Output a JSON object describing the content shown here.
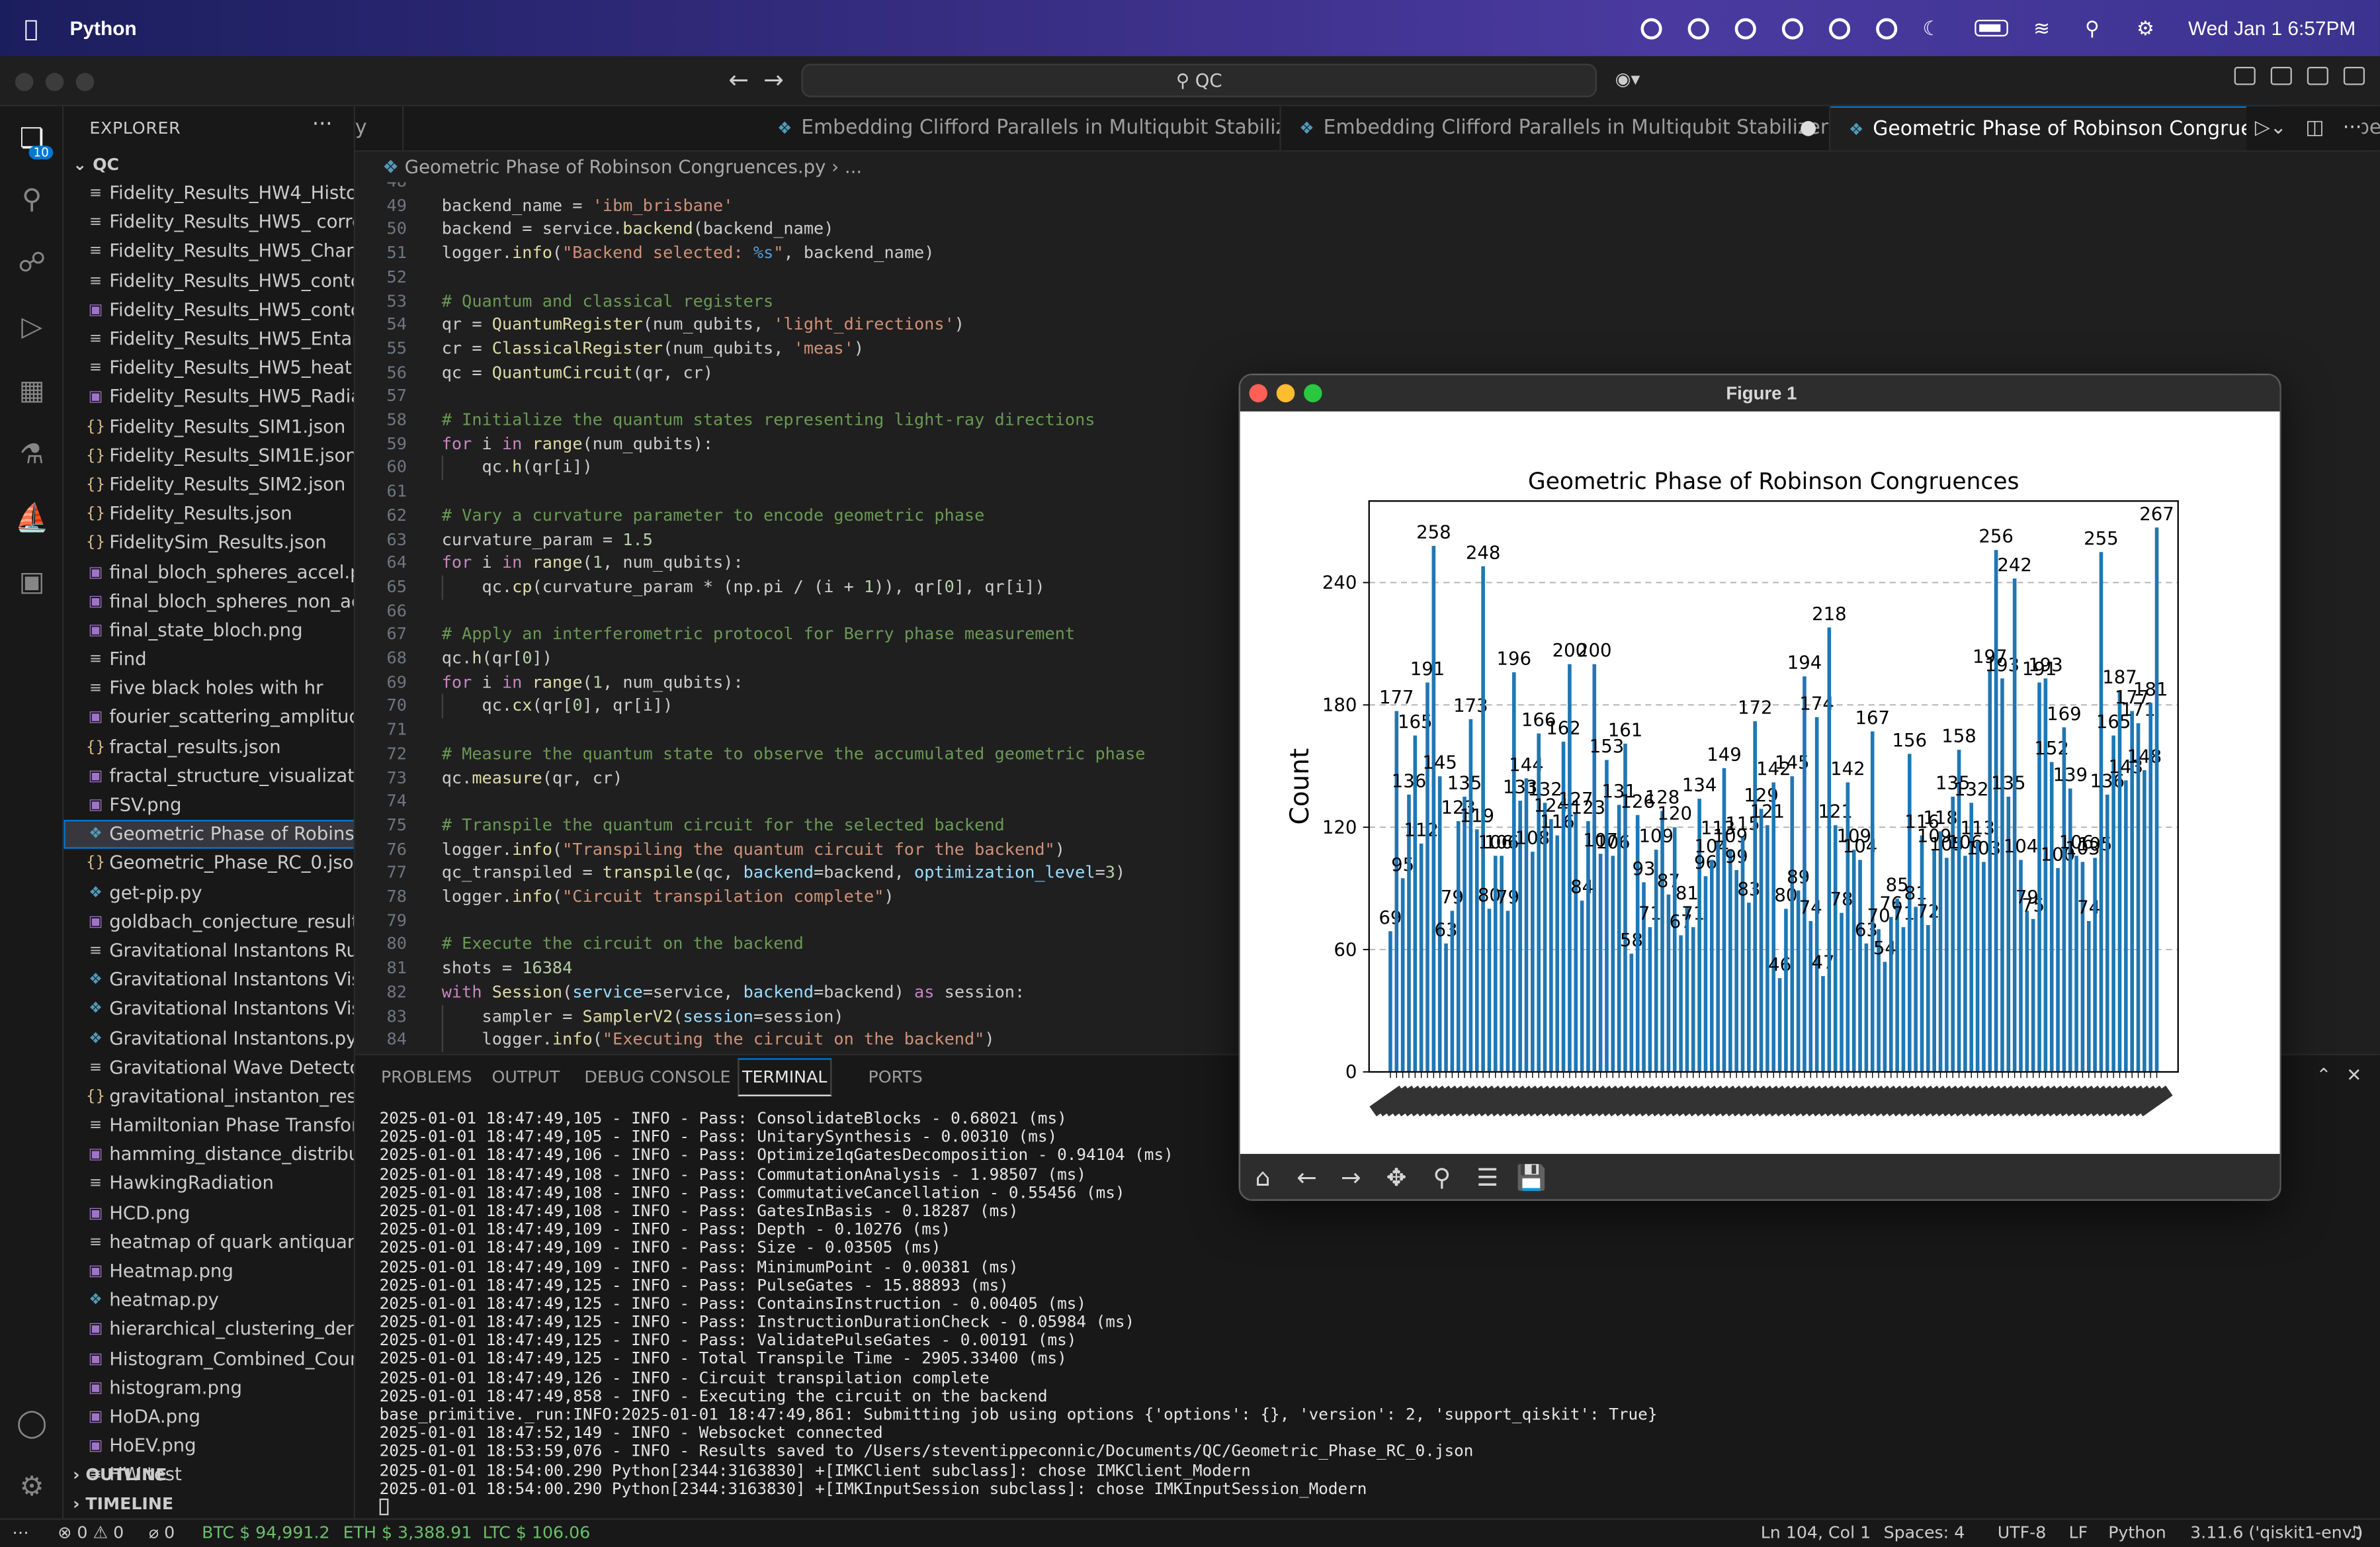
{
  "menubar": {
    "app": "Python",
    "datetime": "Wed Jan 1  6:57PM"
  },
  "titlebar": {
    "search": "QC"
  },
  "activity": {
    "badge": "10"
  },
  "explorer": {
    "title": "EXPLORER",
    "root": "QC",
    "files": [
      {
        "name": "Fidelity_Results_HW4_Histo...",
        "kind": "txt"
      },
      {
        "name": "Fidelity_Results_HW5_ corre...",
        "kind": "txt"
      },
      {
        "name": "Fidelity_Results_HW5_Chart1",
        "kind": "txt"
      },
      {
        "name": "Fidelity_Results_HW5_conto...",
        "kind": "txt"
      },
      {
        "name": "Fidelity_Results_HW5_conto...",
        "kind": "png"
      },
      {
        "name": "Fidelity_Results_HW5_Entan...",
        "kind": "txt"
      },
      {
        "name": "Fidelity_Results_HW5_heat ...",
        "kind": "txt"
      },
      {
        "name": "Fidelity_Results_HW5_Radia...",
        "kind": "png"
      },
      {
        "name": "Fidelity_Results_SIM1.json",
        "kind": "json"
      },
      {
        "name": "Fidelity_Results_SIM1E.json",
        "kind": "json"
      },
      {
        "name": "Fidelity_Results_SIM2.json",
        "kind": "json"
      },
      {
        "name": "Fidelity_Results.json",
        "kind": "json"
      },
      {
        "name": "FidelitySim_Results.json",
        "kind": "json"
      },
      {
        "name": "final_bloch_spheres_accel.p...",
        "kind": "png"
      },
      {
        "name": "final_bloch_spheres_non_ac...",
        "kind": "png"
      },
      {
        "name": "final_state_bloch.png",
        "kind": "png"
      },
      {
        "name": "Find",
        "kind": "txt"
      },
      {
        "name": "Five black holes with hr",
        "kind": "txt"
      },
      {
        "name": "fourier_scattering_amplitud...",
        "kind": "png"
      },
      {
        "name": "fractal_results.json",
        "kind": "json"
      },
      {
        "name": "fractal_structure_visualizati...",
        "kind": "png"
      },
      {
        "name": "FSV.png",
        "kind": "png"
      },
      {
        "name": "Geometric Phase of Robinso...",
        "kind": "py",
        "selected": true
      },
      {
        "name": "Geometric_Phase_RC_0.json",
        "kind": "json"
      },
      {
        "name": "get-pip.py",
        "kind": "py"
      },
      {
        "name": "goldbach_conjecture_result...",
        "kind": "png"
      },
      {
        "name": "Gravitational Instantons Run...",
        "kind": "txt"
      },
      {
        "name": "Gravitational Instantons Visu...",
        "kind": "py"
      },
      {
        "name": "Gravitational Instantons Visu...",
        "kind": "py"
      },
      {
        "name": "Gravitational Instantons.py",
        "kind": "py"
      },
      {
        "name": "Gravitational Wave Detector",
        "kind": "txt"
      },
      {
        "name": "gravitational_instanton_resu...",
        "kind": "json"
      },
      {
        "name": "Hamiltonian Phase Transfor...",
        "kind": "txt"
      },
      {
        "name": "hamming_distance_distribut...",
        "kind": "png"
      },
      {
        "name": "HawkingRadiation",
        "kind": "txt"
      },
      {
        "name": "HCD.png",
        "kind": "png"
      },
      {
        "name": "heatmap of quark antiquark i...",
        "kind": "txt"
      },
      {
        "name": "Heatmap.png",
        "kind": "png"
      },
      {
        "name": "heatmap.py",
        "kind": "py"
      },
      {
        "name": "hierarchical_clustering_den...",
        "kind": "png"
      },
      {
        "name": "Histogram_Combined_Coun...",
        "kind": "png"
      },
      {
        "name": "histogram.png",
        "kind": "png"
      },
      {
        "name": "HoDA.png",
        "kind": "png"
      },
      {
        "name": "HoEV.png",
        "kind": "png"
      },
      {
        "name": "HW test",
        "kind": "txt"
      }
    ],
    "outline": "OUTLINE",
    "timeline": "TIMELINE"
  },
  "tabs": [
    {
      "label": "y",
      "active": false
    },
    {
      "label": "Embedding Clifford Parallels in Multiqubit Stabilizers.py",
      "active": false
    },
    {
      "label": "Embedding Clifford Parallels in Multiqubit Stabilizers V1.py",
      "active": false,
      "dirty": true
    },
    {
      "label": "Geometric Phase of Robinson Congruences.py",
      "active": true,
      "dirty": true
    },
    {
      "label": "Embedding Clifford Parallels in Mu",
      "active": false
    }
  ],
  "breadcrumb": {
    "file": "Geometric Phase of Robinson Congruences.py",
    "rest": "..."
  },
  "code_lines": [
    {
      "n": "48",
      "html": ""
    },
    {
      "n": "49",
      "html": "backend_name = <span class='s'>'ibm_brisbane'</span>"
    },
    {
      "n": "50",
      "html": "backend = service.<span class='f'>backend</span>(backend_name)"
    },
    {
      "n": "51",
      "html": "logger.<span class='f'>info</span>(<span class='s'>\"Backend selected: </span><span class='b'>%s</span><span class='s'>\"</span>, backend_name)"
    },
    {
      "n": "52",
      "html": ""
    },
    {
      "n": "53",
      "html": "<span class='c'># Quantum and classical registers</span>"
    },
    {
      "n": "54",
      "html": "qr = <span class='f'>QuantumRegister</span>(num_qubits, <span class='s'>'light_directions'</span>)"
    },
    {
      "n": "55",
      "html": "cr = <span class='f'>ClassicalRegister</span>(num_qubits, <span class='s'>'meas'</span>)"
    },
    {
      "n": "56",
      "html": "qc = <span class='f'>QuantumCircuit</span>(qr, cr)"
    },
    {
      "n": "57",
      "html": ""
    },
    {
      "n": "58",
      "html": "<span class='c'># Initialize the quantum states representing light-ray directions</span>"
    },
    {
      "n": "59",
      "html": "<span class='k'>for</span> i <span class='k'>in</span> <span class='f'>range</span>(num_qubits):"
    },
    {
      "n": "60",
      "html": "    qc.<span class='f'>h</span>(qr[i])"
    },
    {
      "n": "61",
      "html": ""
    },
    {
      "n": "62",
      "html": "<span class='c'># Vary a curvature parameter to encode geometric phase</span>"
    },
    {
      "n": "63",
      "html": "curvature_param = <span class='n'>1.5</span>"
    },
    {
      "n": "64",
      "html": "<span class='k'>for</span> i <span class='k'>in</span> <span class='f'>range</span>(<span class='n'>1</span>, num_qubits):"
    },
    {
      "n": "65",
      "html": "    qc.<span class='f'>cp</span>(curvature_param * (np.pi / (i + <span class='n'>1</span>)), qr[<span class='n'>0</span>], qr[i])"
    },
    {
      "n": "66",
      "html": ""
    },
    {
      "n": "67",
      "html": "<span class='c'># Apply an interferometric protocol for Berry phase measurement</span>"
    },
    {
      "n": "68",
      "html": "qc.<span class='f'>h</span>(qr[<span class='n'>0</span>])"
    },
    {
      "n": "69",
      "html": "<span class='k'>for</span> i <span class='k'>in</span> <span class='f'>range</span>(<span class='n'>1</span>, num_qubits):"
    },
    {
      "n": "70",
      "html": "    qc.<span class='f'>cx</span>(qr[<span class='n'>0</span>], qr[i])"
    },
    {
      "n": "71",
      "html": ""
    },
    {
      "n": "72",
      "html": "<span class='c'># Measure the quantum state to observe the accumulated geometric phase</span>"
    },
    {
      "n": "73",
      "html": "qc.<span class='f'>measure</span>(qr, cr)"
    },
    {
      "n": "74",
      "html": ""
    },
    {
      "n": "75",
      "html": "<span class='c'># Transpile the quantum circuit for the selected backend</span>"
    },
    {
      "n": "76",
      "html": "logger.<span class='f'>info</span>(<span class='s'>\"Transpiling the quantum circuit for the backend\"</span>)"
    },
    {
      "n": "77",
      "html": "qc_transpiled = <span class='f'>transpile</span>(qc, <span class='v'>backend</span>=backend, <span class='v'>optimization_level</span>=<span class='n'>3</span>)"
    },
    {
      "n": "78",
      "html": "logger.<span class='f'>info</span>(<span class='s'>\"Circuit transpilation complete\"</span>)"
    },
    {
      "n": "79",
      "html": ""
    },
    {
      "n": "80",
      "html": "<span class='c'># Execute the circuit on the backend</span>"
    },
    {
      "n": "81",
      "html": "shots = <span class='n'>16384</span>"
    },
    {
      "n": "82",
      "html": "<span class='k'>with</span> <span class='f'>Session</span>(<span class='v'>service</span>=service, <span class='v'>backend</span>=backend) <span class='k'>as</span> session:"
    },
    {
      "n": "83",
      "html": "    sampler = <span class='f'>SamplerV2</span>(<span class='v'>session</span>=session)"
    },
    {
      "n": "84",
      "html": "    logger.<span class='f'>info</span>(<span class='s'>\"Executing the circuit on the backend\"</span>)"
    }
  ],
  "panel": {
    "tabs": [
      "PROBLEMS",
      "OUTPUT",
      "DEBUG CONSOLE",
      "TERMINAL",
      "PORTS"
    ],
    "active": "TERMINAL",
    "lines": [
      "2025-01-01 18:47:49,105 - INFO - Pass: ConsolidateBlocks - 0.68021 (ms)",
      "2025-01-01 18:47:49,105 - INFO - Pass: UnitarySynthesis - 0.00310 (ms)",
      "2025-01-01 18:47:49,106 - INFO - Pass: Optimize1qGatesDecomposition - 0.94104 (ms)",
      "2025-01-01 18:47:49,108 - INFO - Pass: CommutationAnalysis - 1.98507 (ms)",
      "2025-01-01 18:47:49,108 - INFO - Pass: CommutativeCancellation - 0.55456 (ms)",
      "2025-01-01 18:47:49,108 - INFO - Pass: GatesInBasis - 0.18287 (ms)",
      "2025-01-01 18:47:49,109 - INFO - Pass: Depth - 0.10276 (ms)",
      "2025-01-01 18:47:49,109 - INFO - Pass: Size - 0.03505 (ms)",
      "2025-01-01 18:47:49,109 - INFO - Pass: MinimumPoint - 0.00381 (ms)",
      "2025-01-01 18:47:49,125 - INFO - Pass: PulseGates - 15.88893 (ms)",
      "2025-01-01 18:47:49,125 - INFO - Pass: ContainsInstruction - 0.00405 (ms)",
      "2025-01-01 18:47:49,125 - INFO - Pass: InstructionDurationCheck - 0.05984 (ms)",
      "2025-01-01 18:47:49,125 - INFO - Pass: ValidatePulseGates - 0.00191 (ms)",
      "2025-01-01 18:47:49,125 - INFO - Total Transpile Time - 2905.33400 (ms)",
      "2025-01-01 18:47:49,126 - INFO - Circuit transpilation complete",
      "2025-01-01 18:47:49,858 - INFO - Executing the circuit on the backend",
      "base_primitive._run:INFO:2025-01-01 18:47:49,861: Submitting job using options {'options': {}, 'version': 2, 'support_qiskit': True}",
      "2025-01-01 18:47:52,149 - INFO - Websocket connected",
      "2025-01-01 18:53:59,076 - INFO - Results saved to /Users/steventippeconnic/Documents/QC/Geometric_Phase_RC_0.json",
      "2025-01-01 18:54:00.290 Python[2344:3163830] +[IMKClient subclass]: chose IMKClient_Modern",
      "2025-01-01 18:54:00.290 Python[2344:3163830] +[IMKInputSession subclass]: chose IMKInputSession_Modern"
    ]
  },
  "statusbar": {
    "problems": "0",
    "warnings": "0",
    "ports": "0",
    "btc": "BTC $ 94,991.2",
    "eth": "ETH $ 3,388.91",
    "ltc": "LTC $ 106.06",
    "position": "Ln 104, Col 1",
    "spaces": "Spaces: 4",
    "encoding": "UTF-8",
    "eol": "LF",
    "language": "Python",
    "interpreter": "3.11.6 ('qiskit1-env')"
  },
  "figure": {
    "window_title": "Figure 1"
  },
  "chart_data": {
    "type": "bar",
    "title": "Geometric Phase of Robinson Congruences",
    "ylabel": "Count",
    "xlabel": "",
    "ylim": [
      0,
      280
    ],
    "yticks": [
      0,
      60,
      120,
      180,
      240
    ],
    "bar_color": "#1f77b4",
    "grid": "y, dashed",
    "values": [
      69,
      177,
      95,
      136,
      165,
      112,
      191,
      258,
      145,
      63,
      79,
      123,
      135,
      173,
      119,
      248,
      80,
      106,
      106,
      79,
      196,
      133,
      144,
      108,
      166,
      132,
      124,
      116,
      162,
      200,
      127,
      84,
      123,
      200,
      107,
      153,
      106,
      131,
      161,
      58,
      126,
      93,
      71,
      109,
      128,
      87,
      120,
      67,
      81,
      71,
      134,
      96,
      104,
      113,
      149,
      109,
      99,
      115,
      83,
      172,
      129,
      121,
      142,
      46,
      80,
      145,
      89,
      194,
      74,
      174,
      47,
      218,
      121,
      78,
      142,
      109,
      104,
      63,
      167,
      70,
      54,
      76,
      85,
      71,
      156,
      81,
      116,
      72,
      109,
      118,
      105,
      135,
      158,
      106,
      132,
      113,
      103,
      197,
      256,
      193,
      135,
      242,
      104,
      79,
      75,
      191,
      193,
      152,
      100,
      169,
      139,
      106,
      103,
      74,
      105,
      255,
      136,
      165,
      187,
      143,
      177,
      171,
      148,
      181,
      267
    ]
  }
}
